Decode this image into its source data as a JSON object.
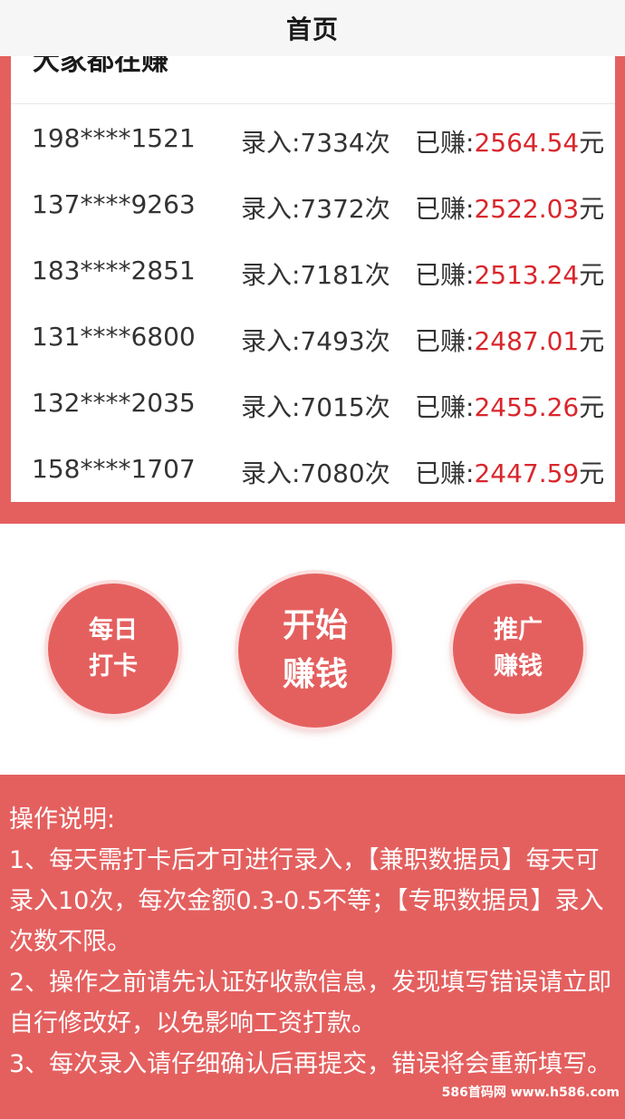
{
  "header": {
    "title": "首页"
  },
  "card": {
    "heading": "大家都在赚",
    "rows": [
      {
        "phone": "198****1521",
        "count": "录入:7334次",
        "earn_prefix": "已赚:",
        "amount": "2564.54",
        "unit": "元"
      },
      {
        "phone": "137****9263",
        "count": "录入:7372次",
        "earn_prefix": "已赚:",
        "amount": "2522.03",
        "unit": "元"
      },
      {
        "phone": "183****2851",
        "count": "录入:7181次",
        "earn_prefix": "已赚:",
        "amount": "2513.24",
        "unit": "元"
      },
      {
        "phone": "131****6800",
        "count": "录入:7493次",
        "earn_prefix": "已赚:",
        "amount": "2487.01",
        "unit": "元"
      },
      {
        "phone": "132****2035",
        "count": "录入:7015次",
        "earn_prefix": "已赚:",
        "amount": "2455.26",
        "unit": "元"
      },
      {
        "phone": "158****1707",
        "count": "录入:7080次",
        "earn_prefix": "已赚:",
        "amount": "2447.59",
        "unit": "元"
      }
    ]
  },
  "actions": {
    "checkin": {
      "line1": "每日",
      "line2": "打卡"
    },
    "start": {
      "line1": "开始",
      "line2": "赚钱"
    },
    "promote": {
      "line1": "推广",
      "line2": "赚钱"
    }
  },
  "instructions": {
    "title": "操作说明:",
    "items": [
      "1、每天需打卡后才可进行录入，【兼职数据员】每天可录入10次，每次金额0.3-0.5不等；【专职数据员】录入次数不限。",
      "2、操作之前请先认证好收款信息，发现填写错误请立即自行修改好，以免影响工资打款。",
      "3、每次录入请仔细确认后再提交，错误将会重新填写。"
    ]
  },
  "watermark": "586首码网 www.h586.com",
  "colors": {
    "accent": "#e4605f",
    "amount": "#d9262c"
  }
}
